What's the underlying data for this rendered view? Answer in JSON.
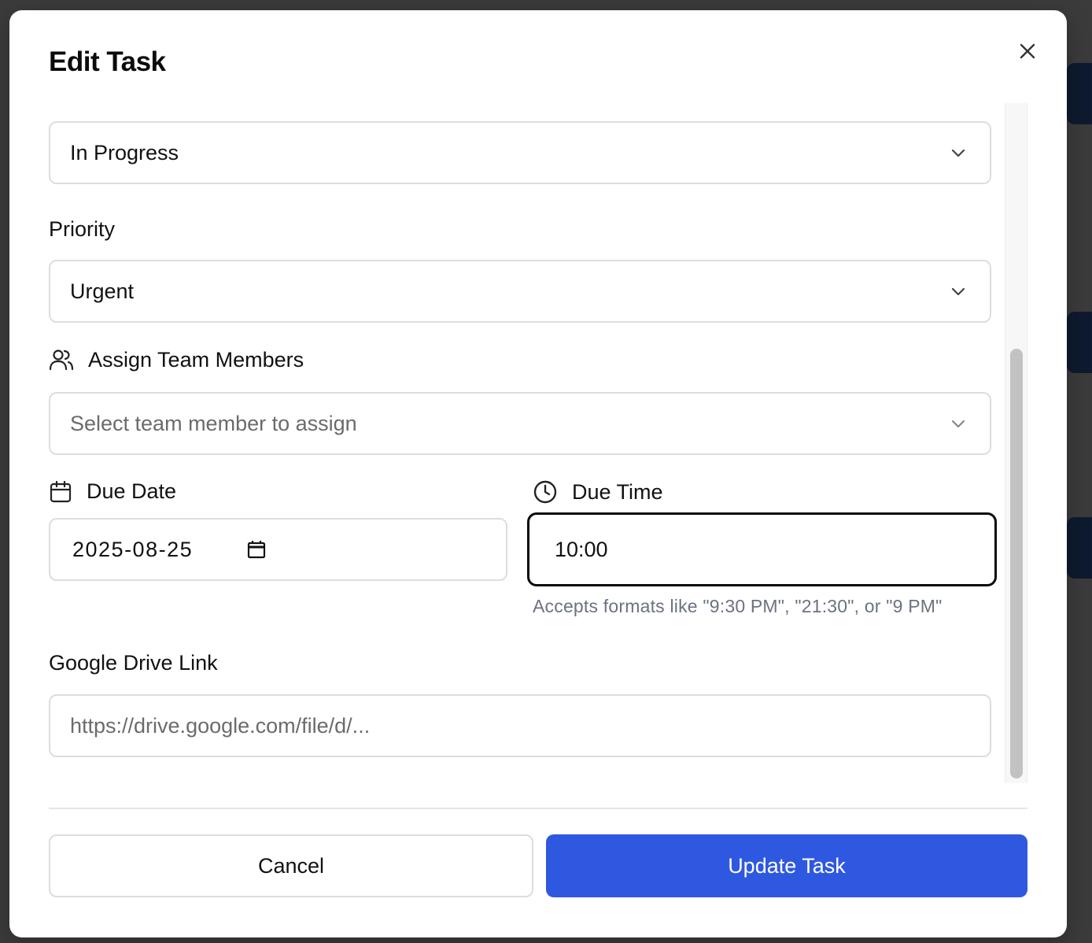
{
  "modal": {
    "title": "Edit Task",
    "close_icon": "close-icon"
  },
  "status": {
    "selected": "In Progress"
  },
  "priority": {
    "label": "Priority",
    "selected": "Urgent"
  },
  "assign": {
    "label": "Assign Team Members",
    "icon": "users-icon",
    "placeholder": "Select team member to assign"
  },
  "due_date": {
    "label": "Due Date",
    "icon": "calendar-icon",
    "value": "2025-08-25"
  },
  "due_time": {
    "label": "Due Time",
    "icon": "clock-icon",
    "value": "10:00",
    "hint": "Accepts formats like \"9:30 PM\", \"21:30\", or \"9 PM\""
  },
  "drive_link": {
    "label": "Google Drive Link",
    "placeholder": "https://drive.google.com/file/d/..."
  },
  "footer": {
    "cancel_label": "Cancel",
    "update_label": "Update Task"
  },
  "colors": {
    "primary": "#2f58e0",
    "border": "#dddde1",
    "overlay": "#3b3b3b"
  }
}
